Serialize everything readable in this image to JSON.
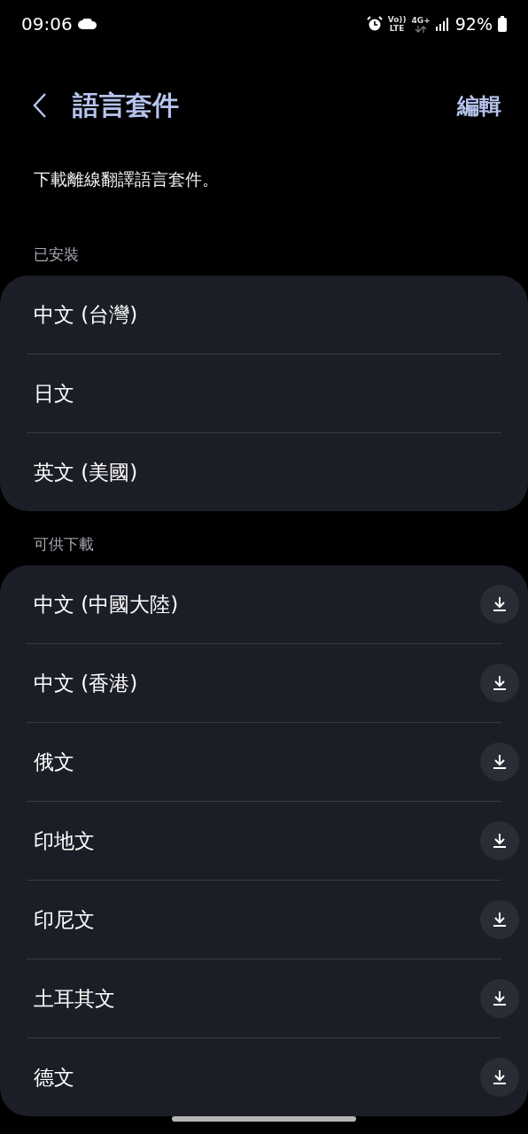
{
  "status_bar": {
    "time": "09:06",
    "volte": "Vo))",
    "volte_sub": "LTE",
    "network": "4G+",
    "battery": "92%"
  },
  "header": {
    "title": "語言套件",
    "action": "編輯"
  },
  "description": "下載離線翻譯語言套件。",
  "sections": [
    {
      "label": "已安裝",
      "items": [
        {
          "name": "中文 (台灣)",
          "kind": "installed"
        },
        {
          "name": "日文",
          "kind": "installed"
        },
        {
          "name": "英文 (美國)",
          "kind": "installed"
        }
      ]
    },
    {
      "label": "可供下載",
      "items": [
        {
          "name": "中文 (中國大陸)",
          "kind": "download"
        },
        {
          "name": "中文 (香港)",
          "kind": "download"
        },
        {
          "name": "俄文",
          "kind": "download"
        },
        {
          "name": "印地文",
          "kind": "download"
        },
        {
          "name": "印尼文",
          "kind": "download"
        },
        {
          "name": "土耳其文",
          "kind": "download"
        },
        {
          "name": "德文",
          "kind": "download"
        }
      ]
    }
  ]
}
